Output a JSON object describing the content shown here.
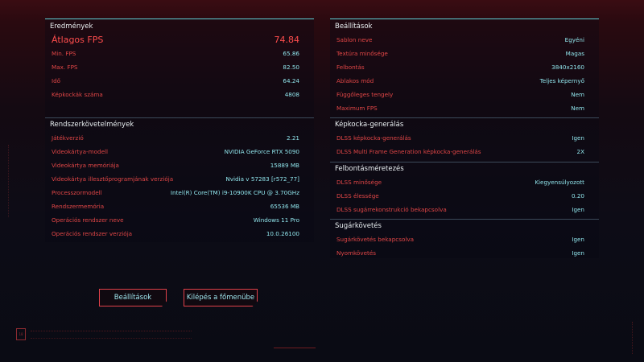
{
  "results": {
    "title": "Eredmények",
    "avg_fps_label": "Átlagos FPS",
    "avg_fps_value": "74.84",
    "rows": [
      {
        "label": "Min. FPS",
        "value": "65.86"
      },
      {
        "label": "Max. FPS",
        "value": "82.50"
      },
      {
        "label": "Idő",
        "value": "64.24"
      },
      {
        "label": "Képkockák száma",
        "value": "4808"
      }
    ]
  },
  "system": {
    "title": "Rendszerkövetelmények",
    "rows": [
      {
        "label": "Játékverzió",
        "value": "2.21"
      },
      {
        "label": "Videokártya-modell",
        "value": "NVIDIA GeForce RTX 5090"
      },
      {
        "label": "Videokártya memóriája",
        "value": "15889 MB"
      },
      {
        "label": "Videokártya illesztőprogramjának verziója",
        "value": "Nvidia v 57283 [r572_77]"
      },
      {
        "label": "Processzormodell",
        "value": "Intel(R) Core(TM) i9-10900K CPU @ 3.70GHz"
      },
      {
        "label": "Rendszermemória",
        "value": "65536 MB"
      },
      {
        "label": "Operációs rendszer neve",
        "value": "Windows 11 Pro"
      },
      {
        "label": "Operációs rendszer verziója",
        "value": "10.0.26100"
      }
    ]
  },
  "settings": {
    "title": "Beállítások",
    "rows": [
      {
        "label": "Sablon neve",
        "value": "Egyéni"
      },
      {
        "label": "Textúra minősége",
        "value": "Magas"
      },
      {
        "label": "Felbontás",
        "value": "3840x2160"
      },
      {
        "label": "Ablakos mód",
        "value": "Teljes képernyő"
      },
      {
        "label": "Függőleges tengely",
        "value": "Nem"
      },
      {
        "label": "Maximum FPS",
        "value": "Nem"
      }
    ]
  },
  "framegen": {
    "title": "Képkocka-generálás",
    "rows": [
      {
        "label": "DLSS képkocka-generálás",
        "value": "Igen"
      },
      {
        "label": "DLSS Multi Frame Generation képkocka-generálás",
        "value": "2X"
      }
    ]
  },
  "scaling": {
    "title": "Felbontásméretezés",
    "rows": [
      {
        "label": "DLSS minősége",
        "value": "Kiegyensúlyozott"
      },
      {
        "label": "DLSS élessége",
        "value": "0.20"
      },
      {
        "label": "DLSS sugárrekonstrukció bekapcsolva",
        "value": "Igen"
      }
    ]
  },
  "raytracing": {
    "title": "Sugárkövetés",
    "rows": [
      {
        "label": "Sugárkövetés bekapcsolva",
        "value": "Igen"
      },
      {
        "label": "Nyomkövetés",
        "value": "Igen"
      }
    ]
  },
  "buttons": {
    "settings": "Beállítások",
    "exit": "Kilépés a főmenübe"
  },
  "colors": {
    "accent_red": "#e04646",
    "accent_cyan": "#8fe3ea",
    "border_cyan": "#5fd0d6"
  }
}
